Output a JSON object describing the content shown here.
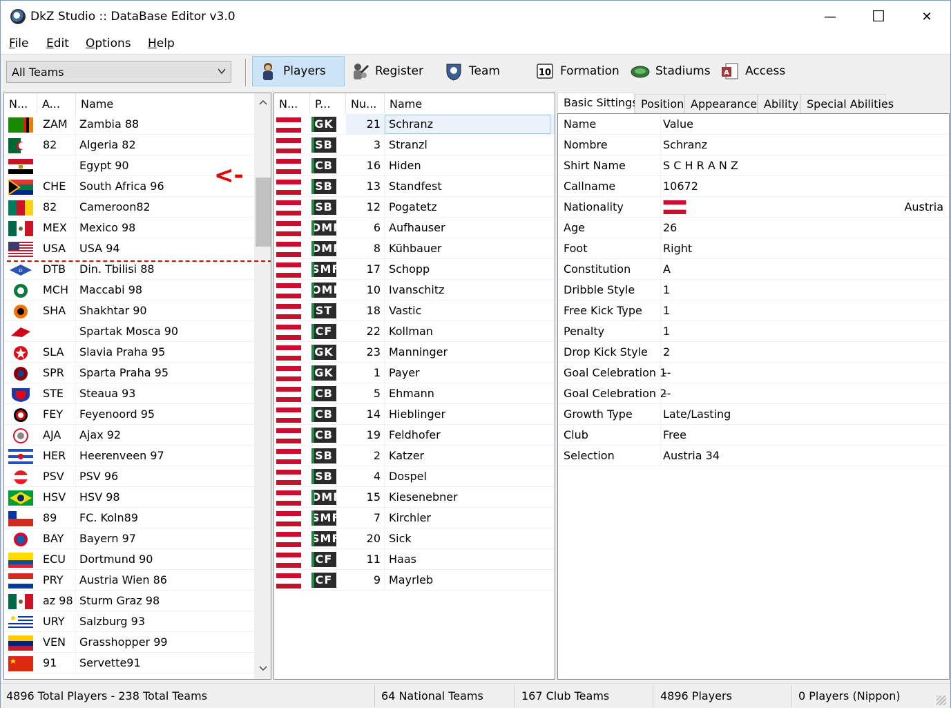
{
  "window": {
    "title": "DkZ Studio :: DataBase Editor v3.0",
    "minimize": "—",
    "maximize": "☐",
    "close": "✕"
  },
  "menu": [
    "File",
    "Edit",
    "Options",
    "Help"
  ],
  "menu_underline": [
    "F",
    "E",
    "O",
    "H"
  ],
  "menu_rest": [
    "ile",
    "dit",
    "ptions",
    "elp"
  ],
  "toolbar": {
    "team_filter": "All Teams",
    "buttons": [
      {
        "label": "Players",
        "icon": "player-icon",
        "active": true
      },
      {
        "label": "Register",
        "icon": "register-icon",
        "active": false
      },
      {
        "label": "Team",
        "icon": "team-icon",
        "active": false
      },
      {
        "label": "Formation",
        "icon": "formation-icon",
        "active": false
      },
      {
        "label": "Stadiums",
        "icon": "stadium-icon",
        "active": false
      },
      {
        "label": "Access",
        "icon": "access-icon",
        "active": false
      }
    ]
  },
  "teams": {
    "headers": [
      "N...",
      "A...",
      "Name"
    ],
    "rows": [
      {
        "abbr": "ZAM",
        "name": "Zambia 88",
        "flag": "zambia"
      },
      {
        "abbr": "82",
        "name": "Algeria 82",
        "flag": "algeria"
      },
      {
        "abbr": "",
        "name": "Egypt 90",
        "flag": "egypt"
      },
      {
        "abbr": "CHE",
        "name": "South Africa 96",
        "flag": "southafrica"
      },
      {
        "abbr": "82",
        "name": "Cameroon82",
        "flag": "cameroon"
      },
      {
        "abbr": "MEX",
        "name": "Mexico 98",
        "flag": "mexico"
      },
      {
        "abbr": "USA",
        "name": "USA 94",
        "flag": "usa"
      },
      {
        "abbr": "DTB",
        "name": "Din. Tbilisi 88",
        "flag": "dinamo"
      },
      {
        "abbr": "MCH",
        "name": "Maccabi 98",
        "flag": "maccabi"
      },
      {
        "abbr": "SHA",
        "name": "Shakhtar 90",
        "flag": "shakhtar"
      },
      {
        "abbr": "",
        "name": "Spartak Mosca 90",
        "flag": "spartak"
      },
      {
        "abbr": "SLA",
        "name": "Slavia Praha 95",
        "flag": "slavia"
      },
      {
        "abbr": "SPR",
        "name": "Sparta Praha 95",
        "flag": "sparta"
      },
      {
        "abbr": "STE",
        "name": "Steaua 93",
        "flag": "steaua"
      },
      {
        "abbr": "FEY",
        "name": "Feyenoord 95",
        "flag": "feyenoord"
      },
      {
        "abbr": "AJA",
        "name": "Ajax 92",
        "flag": "ajax"
      },
      {
        "abbr": "HER",
        "name": "Heerenveen 97",
        "flag": "heerenveen"
      },
      {
        "abbr": "PSV",
        "name": "PSV 96",
        "flag": "psv"
      },
      {
        "abbr": "HSV",
        "name": "HSV 98",
        "flag": "brazil"
      },
      {
        "abbr": "89",
        "name": "FC. Koln89",
        "flag": "chile"
      },
      {
        "abbr": "BAY",
        "name": "Bayern 97",
        "flag": "bayern"
      },
      {
        "abbr": "ECU",
        "name": "Dortmund 90",
        "flag": "ecuador"
      },
      {
        "abbr": "PRY",
        "name": "Austria Wien 86",
        "flag": "paraguay"
      },
      {
        "abbr": "az 98",
        "name": "Sturm Graz 98",
        "flag": "mexico"
      },
      {
        "abbr": "URY",
        "name": "Salzburg 93",
        "flag": "uruguay"
      },
      {
        "abbr": "VEN",
        "name": "Grasshopper 99",
        "flag": "venezuela"
      },
      {
        "abbr": "91",
        "name": "Servette91",
        "flag": "china"
      }
    ],
    "annotation": "<-"
  },
  "players": {
    "headers": [
      "N...",
      "P...",
      "Nu...",
      "Name"
    ],
    "rows": [
      {
        "pos": "GK",
        "num": "21",
        "name": "Schranz"
      },
      {
        "pos": "SB",
        "num": "3",
        "name": "Stranzl"
      },
      {
        "pos": "CB",
        "num": "16",
        "name": "Hiden"
      },
      {
        "pos": "SB",
        "num": "13",
        "name": "Standfest"
      },
      {
        "pos": "SB",
        "num": "12",
        "name": "Pogatetz"
      },
      {
        "pos": "DMF",
        "num": "6",
        "name": "Aufhauser"
      },
      {
        "pos": "DMF",
        "num": "8",
        "name": "Kühbauer"
      },
      {
        "pos": "SMF",
        "num": "17",
        "name": "Schopp"
      },
      {
        "pos": "OMF",
        "num": "10",
        "name": "Ivanschitz"
      },
      {
        "pos": "ST",
        "num": "18",
        "name": "Vastic"
      },
      {
        "pos": "CF",
        "num": "22",
        "name": "Kollman"
      },
      {
        "pos": "GK",
        "num": "23",
        "name": "Manninger"
      },
      {
        "pos": "GK",
        "num": "1",
        "name": "Payer"
      },
      {
        "pos": "CB",
        "num": "5",
        "name": "Ehmann"
      },
      {
        "pos": "CB",
        "num": "14",
        "name": "Hieblinger"
      },
      {
        "pos": "CB",
        "num": "19",
        "name": "Feldhofer"
      },
      {
        "pos": "SB",
        "num": "2",
        "name": "Katzer"
      },
      {
        "pos": "SB",
        "num": "4",
        "name": "Dospel"
      },
      {
        "pos": "DMF",
        "num": "15",
        "name": "Kiesenebner"
      },
      {
        "pos": "SMF",
        "num": "7",
        "name": "Kirchler"
      },
      {
        "pos": "SMF",
        "num": "20",
        "name": "Sick"
      },
      {
        "pos": "CF",
        "num": "11",
        "name": "Haas"
      },
      {
        "pos": "CF",
        "num": "9",
        "name": "Mayrleb"
      }
    ]
  },
  "details": {
    "tabs": [
      "Basic Sittings",
      "Position",
      "Appearance",
      "Ability",
      "Special Abilities"
    ],
    "header": {
      "key": "Name",
      "value": "Value"
    },
    "rows": [
      {
        "key": "Nombre",
        "value": "Schranz"
      },
      {
        "key": "Shirt Name",
        "value": "S C H R A N Z"
      },
      {
        "key": "Callname",
        "value": "10672"
      },
      {
        "key": "Nationality",
        "value": "Austria",
        "flag": true
      },
      {
        "key": "Age",
        "value": "26"
      },
      {
        "key": "Foot",
        "value": "Right"
      },
      {
        "key": "Constitution",
        "value": "A"
      },
      {
        "key": "Dribble Style",
        "value": "1"
      },
      {
        "key": "Free Kick Type",
        "value": "1"
      },
      {
        "key": "Penalty",
        "value": "1"
      },
      {
        "key": "Drop Kick Style",
        "value": "2"
      },
      {
        "key": "Goal Celebration 1",
        "value": "--"
      },
      {
        "key": "Goal Celebration 2",
        "value": "--"
      },
      {
        "key": "Growth Type",
        "value": "Late/Lasting"
      },
      {
        "key": "Club",
        "value": "Free"
      },
      {
        "key": "Selection",
        "value": "Austria 34"
      }
    ]
  },
  "status": {
    "summary": "4896 Total Players  -  238 Total Teams",
    "national": "64 National Teams",
    "club": "167 Club Teams",
    "players": "4896 Players",
    "nippon": "0 Players (Nippon)"
  },
  "colors": {
    "austria_red": "#c8102e",
    "selection": "#cce4f7",
    "annotation": "#e00000"
  }
}
